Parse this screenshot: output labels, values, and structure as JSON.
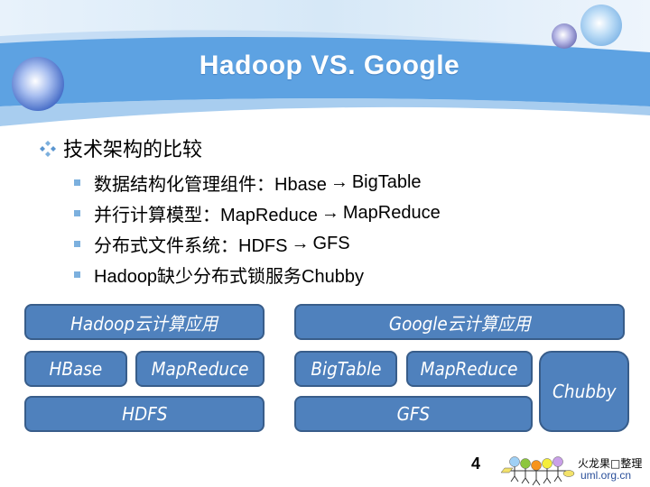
{
  "slide": {
    "title": "Hadoop VS. Google",
    "heading": "技术架构的比较",
    "bullets": [
      {
        "prefix": "数据结构化管理组件：Hbase",
        "arrow": "→",
        "suffix": "BigTable"
      },
      {
        "prefix": "并行计算模型：MapReduce",
        "arrow": "→",
        "suffix": "MapReduce"
      },
      {
        "prefix": "分布式文件系统：HDFS",
        "arrow": "→",
        "suffix": "GFS"
      },
      {
        "prefix": "Hadoop缺少分布式锁服务Chubby",
        "arrow": "",
        "suffix": ""
      }
    ],
    "page_number": "4"
  },
  "hadoop_stack": {
    "app": "Hadoop云计算应用",
    "left": "HBase",
    "right": "MapReduce",
    "base": "HDFS"
  },
  "google_stack": {
    "app": "Google云计算应用",
    "left": "BigTable",
    "right": "MapReduce",
    "base": "GFS",
    "side": "Chubby"
  },
  "footer": {
    "logo_cn": "火龙果□整理",
    "logo_url": "uml.org.cn"
  },
  "colors": {
    "box_fill": "#4f81bd",
    "box_border": "#385d8a",
    "band": "#5da2e2",
    "bullet": "#7cb0de"
  }
}
